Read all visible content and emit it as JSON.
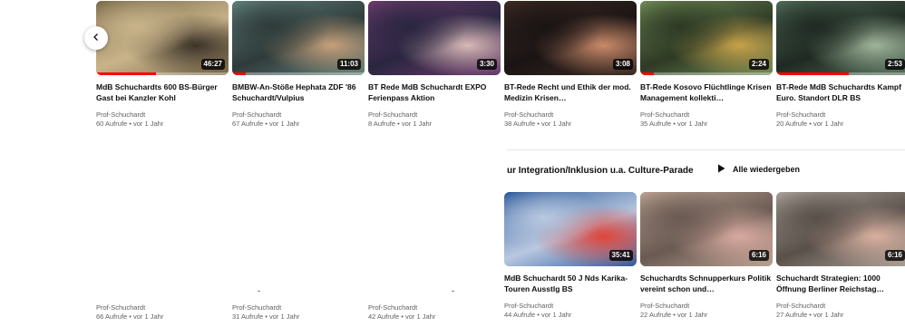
{
  "row1": [
    {
      "title": "MdB Schuchardts 600 BS-Bürger Gast bei Kanzler Kohl",
      "channel": "Prof-Schuchardt",
      "meta": "60 Aufrufe • vor 1 Jahr",
      "duration": "46:27",
      "progress": 0.45,
      "thumb_colors": [
        "#7a6a4a",
        "#3c3328",
        "#c9b48a"
      ]
    },
    {
      "title": "BMBW-An-Stöße Hephata ZDF '86 Schuchardt/Vulpius",
      "channel": "Prof-Schuchardt",
      "meta": "67 Aufrufe • vor 1 Jahr",
      "duration": "11:03",
      "progress": 0.1,
      "thumb_colors": [
        "#5f7f7a",
        "#c5a07b",
        "#2f3b3a"
      ]
    },
    {
      "title": "BT Rede MdB Schuchardt EXPO Ferienpass Aktion",
      "channel": "Prof-Schuchardt",
      "meta": "8 Aufrufe • vor 1 Jahr",
      "duration": "3:30",
      "progress": 0.0,
      "thumb_colors": [
        "#6a3a6c",
        "#d8b8b8",
        "#2a2640"
      ]
    },
    {
      "title": "BT-Rede Recht und Ethik der mod. Medizin Krisen…",
      "channel": "Prof-Schuchardt",
      "meta": "38 Aufrufe • vor 1 Jahr",
      "duration": "3:08",
      "progress": 0.0,
      "thumb_colors": [
        "#3b2a22",
        "#c98a6a",
        "#1a1414"
      ]
    },
    {
      "title": "BT-Rede Kosovo Flüchtlinge Krisen Management kollekti…",
      "channel": "Prof-Schuchardt",
      "meta": "35 Aufrufe • vor 1 Jahr",
      "duration": "2:24",
      "progress": 0.1,
      "thumb_colors": [
        "#6f8a55",
        "#c7a24a",
        "#2e3a25"
      ]
    },
    {
      "title": "BT-Rede MdB Schuchardts Kampf Euro. Standort DLR BS",
      "channel": "Prof-Schuchardt",
      "meta": "20 Aufrufe • vor 1 Jahr",
      "duration": "2:53",
      "progress": 0.55,
      "thumb_colors": [
        "#4f6a56",
        "#9fb49a",
        "#1f2a22"
      ]
    }
  ],
  "row2_left": [
    {
      "channel": "Prof-Schuchardt",
      "meta": "66 Aufrufe • vor 1 Jahr"
    },
    {
      "channel": "Prof-Schuchardt",
      "meta": "31 Aufrufe • vor 1 Jahr"
    },
    {
      "channel": "Prof-Schuchardt",
      "meta": "42 Aufrufe • vor 1 Jahr"
    }
  ],
  "shelf": {
    "title": "ur Integration/Inklusion u.a. Culture-Parade",
    "play_all": "Alle wiedergeben"
  },
  "row2_right": [
    {
      "title": "MdB Schuchardt 50 J Nds Karika-Touren Ausstlg BS",
      "channel": "Prof-Schuchardt",
      "meta": "44 Aufrufe • vor 1 Jahr",
      "duration": "35:41",
      "progress": 0.0,
      "thumb_colors": [
        "#2d5a9a",
        "#e0443a",
        "#b8c8e0"
      ]
    },
    {
      "title": "Schuchardts Schnupperkurs Politik vereint schon und…",
      "channel": "Prof-Schuchardt",
      "meta": "22 Aufrufe • vor 1 Jahr",
      "duration": "6:16",
      "progress": 0.0,
      "thumb_colors": [
        "#b8a090",
        "#d8aaa0",
        "#6a5a52"
      ]
    },
    {
      "title": "Schuchardt Strategien: 1000 Öffnung Berliner Reichstag…",
      "channel": "Prof-Schuchardt",
      "meta": "27 Aufrufe • vor 1 Jahr",
      "duration": "6:16",
      "progress": 0.0,
      "thumb_colors": [
        "#a8a098",
        "#d8b0a0",
        "#5a504a"
      ]
    }
  ],
  "icons": {
    "prev": "chevron-left-icon",
    "play": "play-icon"
  },
  "colors": {
    "progress": "#ff0000",
    "meta_text": "#606060"
  }
}
